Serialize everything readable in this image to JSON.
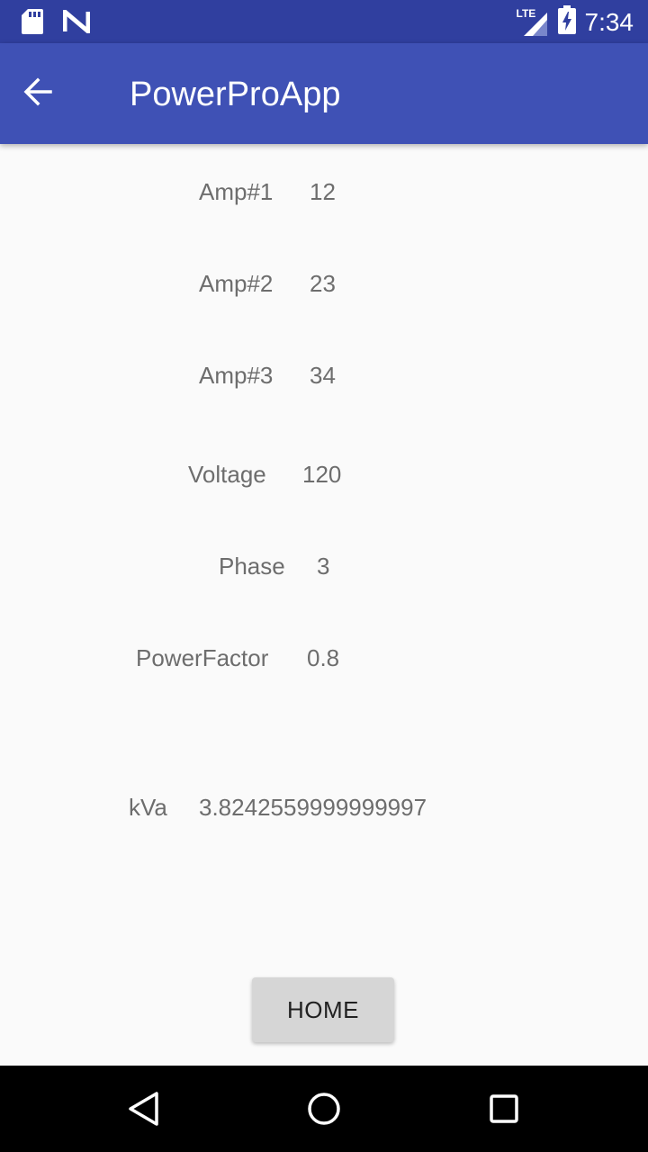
{
  "status_bar": {
    "time": "7:34",
    "network_label": "LTE",
    "icons": [
      "sd-card-icon",
      "n-logo-icon",
      "lte-signal-icon",
      "battery-charging-icon"
    ]
  },
  "app_bar": {
    "title": "PowerProApp",
    "back_icon": "arrow-back-icon"
  },
  "fields": {
    "amp1": {
      "label": "Amp#1",
      "value": "12"
    },
    "amp2": {
      "label": "Amp#2",
      "value": "23"
    },
    "amp3": {
      "label": "Amp#3",
      "value": "34"
    },
    "voltage": {
      "label": "Voltage",
      "value": "120"
    },
    "phase": {
      "label": "Phase",
      "value": "3"
    },
    "power_factor": {
      "label": "PowerFactor",
      "value": "0.8"
    },
    "kva": {
      "label": "kVa",
      "value": "3.8242559999999997"
    }
  },
  "home_button": {
    "label": "HOME"
  },
  "nav_bar": {
    "icons": [
      "back-triangle-icon",
      "home-circle-icon",
      "recents-square-icon"
    ]
  },
  "colors": {
    "status_bar": "#303f9f",
    "app_bar": "#3f51b5",
    "background": "#fafafa",
    "text": "#6d6d6d",
    "button": "#d6d6d6"
  }
}
